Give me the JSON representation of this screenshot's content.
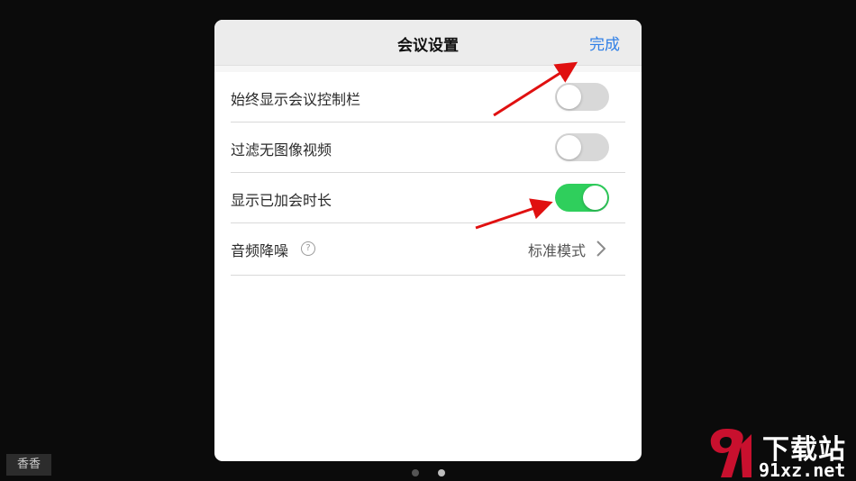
{
  "dialog": {
    "title": "会议设置",
    "done_label": "完成"
  },
  "settings": [
    {
      "label": "始终显示会议控制栏",
      "toggle_on": false
    },
    {
      "label": "过滤无图像视频",
      "toggle_on": false
    },
    {
      "label": "显示已加会时长",
      "toggle_on": true
    },
    {
      "label": "音频降噪",
      "help_glyph": "?",
      "value": "标准模式"
    }
  ],
  "pager": {
    "count": 2,
    "active_index": 1
  },
  "corner_tag": "香香",
  "watermark": {
    "line1": "下载站",
    "line2": "91xz.net"
  },
  "colors": {
    "accent_blue": "#2f7fe6",
    "toggle_on": "#2fcf5c",
    "toggle_off": "#d8d8d8",
    "annotation_arrow": "#e01010",
    "watermark_red": "#c8102e"
  },
  "icons": {
    "help": "question-circle-icon",
    "disclosure": "chevron-right-icon",
    "annotation": "red-arrow-icon"
  }
}
